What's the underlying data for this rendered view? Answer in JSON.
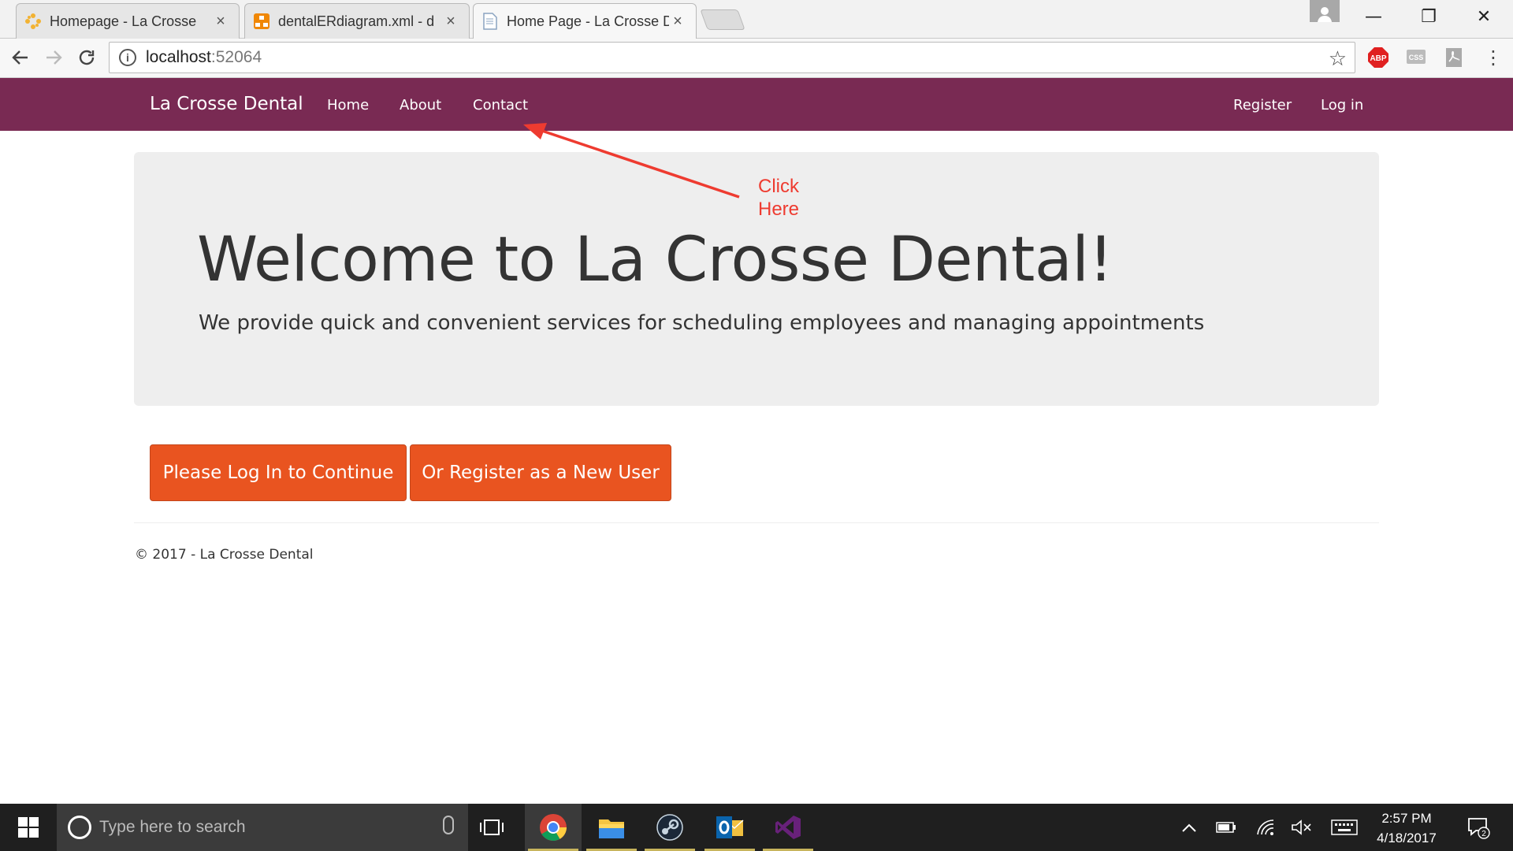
{
  "browser": {
    "tabs": [
      {
        "title": "Homepage - La Crosse",
        "active": false
      },
      {
        "title": "dentalERdiagram.xml - d",
        "active": false
      },
      {
        "title": "Home Page - La Crosse D",
        "active": true
      }
    ],
    "tab_close_glyph": "×",
    "window_controls": {
      "minimize": "—",
      "restore": "❐",
      "close": "✕"
    },
    "address": {
      "host": "localhost",
      "port": ":52064"
    },
    "extensions": [
      "adblock-icon",
      "css-icon",
      "pdf-icon",
      "menu-icon"
    ]
  },
  "site": {
    "brand": "La Crosse Dental",
    "nav_left": [
      "Home",
      "About",
      "Contact"
    ],
    "nav_right": [
      "Register",
      "Log in"
    ],
    "hero": {
      "heading": "Welcome to La Crosse Dental!",
      "subtext": "We provide quick and convenient services for scheduling employees and managing appointments"
    },
    "buttons": {
      "login": "Please Log In to Continue",
      "register": "Or Register as a New User"
    },
    "footer": "© 2017 - La Crosse Dental"
  },
  "annotation": {
    "line1": "Click",
    "line2": "Here",
    "color": "#ee3b30"
  },
  "taskbar": {
    "search_placeholder": "Type here to search",
    "apps": [
      "chrome-icon",
      "file-explorer-icon",
      "steam-icon",
      "outlook-icon",
      "visual-studio-icon"
    ],
    "clock": {
      "time": "2:57 PM",
      "date": "4/18/2017"
    },
    "notification_count": "2"
  },
  "colors": {
    "navbar": "#792a53",
    "button": "#e95420",
    "jumbotron": "#eeeeee"
  }
}
